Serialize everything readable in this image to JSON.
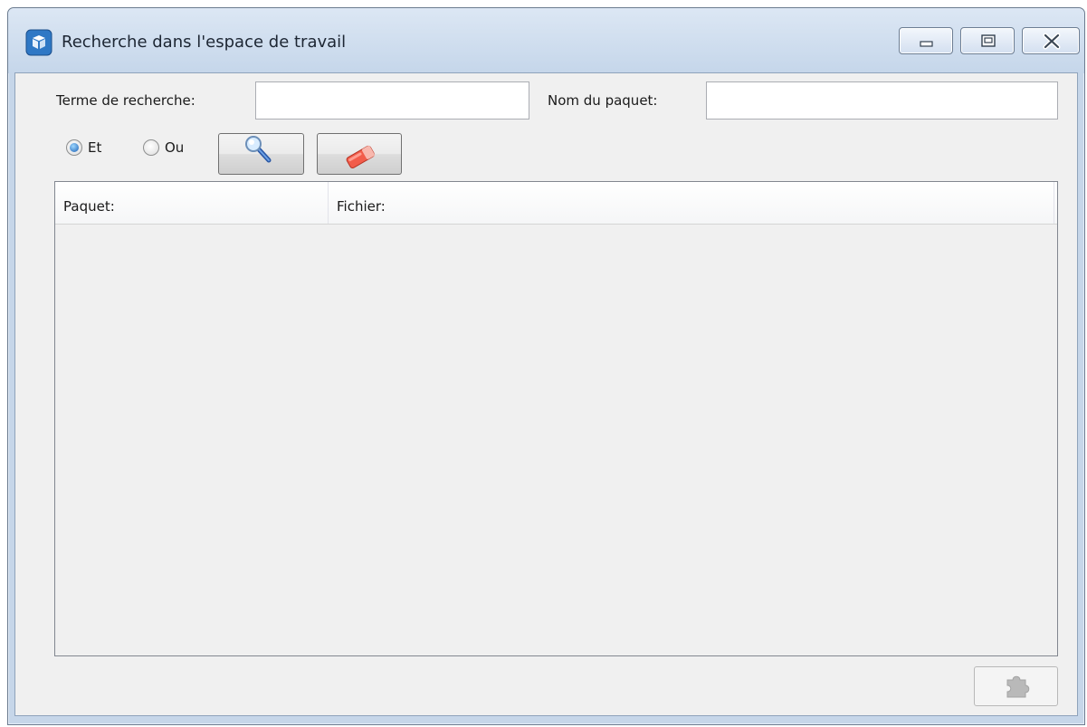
{
  "window": {
    "title": "Recherche dans l'espace de travail"
  },
  "search": {
    "term_label": "Terme de recherche:",
    "term_value": "",
    "package_label": "Nom du paquet:",
    "package_value": ""
  },
  "mode": {
    "and_label": "Et",
    "or_label": "Ou",
    "selected": "Et"
  },
  "results": {
    "columns": [
      "Paquet:",
      "Fichier:"
    ],
    "rows": []
  },
  "icons": {
    "app": "workspace-package-icon",
    "search": "magnifier-icon",
    "clear": "eraser-icon",
    "open": "puzzle-piece-icon"
  },
  "colors": {
    "titlebar": "#c6d6e9",
    "client_background": "#f0f0f0",
    "accent": "#1a5fb4"
  }
}
